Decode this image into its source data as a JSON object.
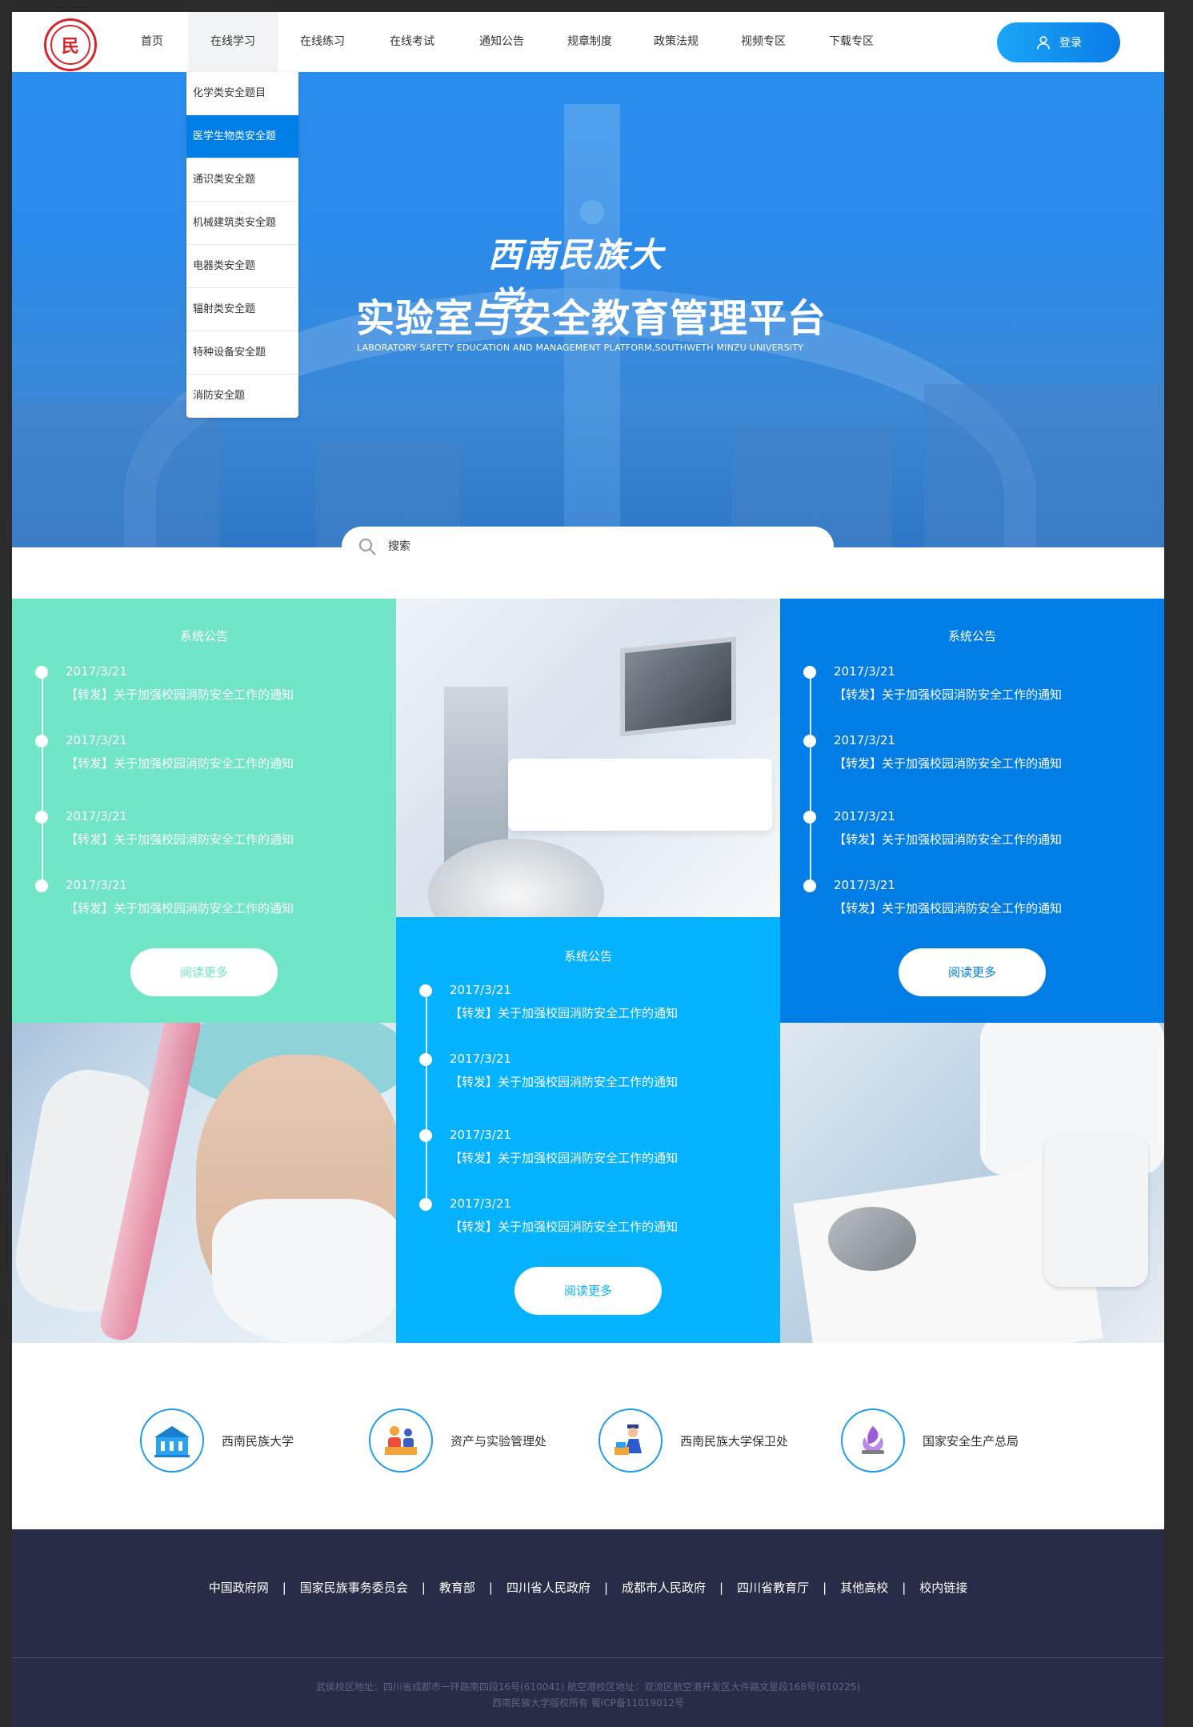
{
  "header": {
    "logo_text": "民",
    "nav": [
      {
        "label": "首页",
        "active": false
      },
      {
        "label": "在线学习",
        "active": true
      },
      {
        "label": "在线练习",
        "active": false
      },
      {
        "label": "在线考试",
        "active": false
      },
      {
        "label": "通知公告",
        "active": false
      },
      {
        "label": "规章制度",
        "active": false
      },
      {
        "label": "政策法规",
        "active": false
      },
      {
        "label": "视频专区",
        "active": false
      },
      {
        "label": "下载专区",
        "active": false
      }
    ],
    "login_label": "登录"
  },
  "dropdown": {
    "items": [
      {
        "label": "化学类安全题目",
        "active": false
      },
      {
        "label": "医学生物类安全题",
        "active": true
      },
      {
        "label": "通识类安全题",
        "active": false
      },
      {
        "label": "机械建筑类安全题",
        "active": false
      },
      {
        "label": "电器类安全题",
        "active": false
      },
      {
        "label": "辐射类安全题",
        "active": false
      },
      {
        "label": "特种设备安全题",
        "active": false
      },
      {
        "label": "消防安全题",
        "active": false
      }
    ]
  },
  "banner": {
    "title_cn": "西南民族大学",
    "title": "实验室与安全教育管理平台",
    "subtitle": "LABORATORY SAFETY EDUCATION AND MANAGEMENT PLATFORM,SOUTHWETH MINZU UNIVERSITY"
  },
  "search": {
    "placeholder": "搜索"
  },
  "notices": [
    {
      "id": "green",
      "bg": "#70e6c6",
      "title": "系统公告",
      "entries": [
        {
          "date": "2017/3/21",
          "text": "【转发】关于加强校园消防安全工作的通知"
        },
        {
          "date": "2017/3/21",
          "text": "【转发】关于加强校园消防安全工作的通知"
        },
        {
          "date": "2017/3/21",
          "text": "【转发】关于加强校园消防安全工作的通知"
        },
        {
          "date": "2017/3/21",
          "text": "【转发】关于加强校园消防安全工作的通知"
        }
      ],
      "more_label": "阅读更多"
    },
    {
      "id": "cyan",
      "bg": "#05b2fe",
      "title": "系统公告",
      "entries": [
        {
          "date": "2017/3/21",
          "text": "【转发】关于加强校园消防安全工作的通知"
        },
        {
          "date": "2017/3/21",
          "text": "【转发】关于加强校园消防安全工作的通知"
        },
        {
          "date": "2017/3/21",
          "text": "【转发】关于加强校园消防安全工作的通知"
        },
        {
          "date": "2017/3/21",
          "text": "【转发】关于加强校园消防安全工作的通知"
        }
      ],
      "more_label": "阅读更多"
    },
    {
      "id": "blue",
      "bg": "#007ee5",
      "title": "系统公告",
      "entries": [
        {
          "date": "2017/3/21",
          "text": "【转发】关于加强校园消防安全工作的通知"
        },
        {
          "date": "2017/3/21",
          "text": "【转发】关于加强校园消防安全工作的通知"
        },
        {
          "date": "2017/3/21",
          "text": "【转发】关于加强校园消防安全工作的通知"
        },
        {
          "date": "2017/3/21",
          "text": "【转发】关于加强校园消防安全工作的通知"
        }
      ],
      "more_label": "阅读更多"
    }
  ],
  "links": [
    {
      "label": "西南民族大学",
      "icon": "university-building-icon"
    },
    {
      "label": "资产与实验管理处",
      "icon": "office-staff-icon"
    },
    {
      "label": "西南民族大学保卫处",
      "icon": "security-guard-icon"
    },
    {
      "label": "国家安全生产总局",
      "icon": "emblem-icon"
    }
  ],
  "footer": {
    "nav": [
      "中国政府网",
      "国家民族事务委员会",
      "教育部",
      "四川省人民政府",
      "成都市人民政府",
      "四川省教育厅",
      "其他高校",
      "校内链接"
    ],
    "separator": "|",
    "address": "武侯校区地址：四川省成都市一环路南四段16号(610041)  航空港校区地址：双流区航空港开发区大件路文星段168号(610225)",
    "copyright": "西南民族大学版权所有      蜀ICP备11019012号"
  },
  "colors": {
    "accent": "#007ee5",
    "green": "#70e6c6",
    "cyan": "#05b2fe",
    "footer_bg": "#292c46"
  }
}
